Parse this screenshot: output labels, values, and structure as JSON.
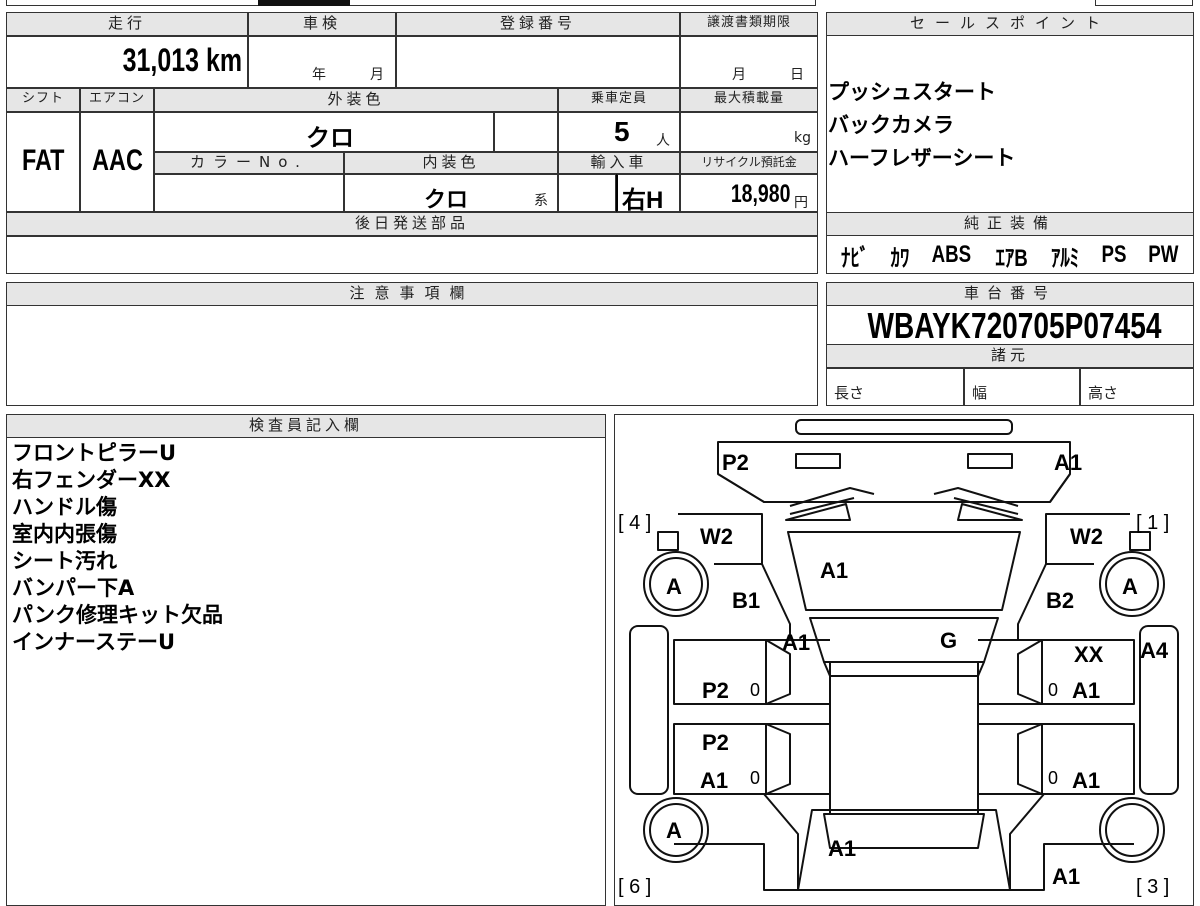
{
  "header": {
    "mileage_label": "走行",
    "inspection_label": "車検",
    "registration_label": "登録番号",
    "transfer_deadline_label": "譲渡書類期限",
    "shift_label": "シフト",
    "aircon_label": "エアコン",
    "exterior_color_label": "外装色",
    "capacity_label": "乗車定員",
    "max_load_label": "最大積載量",
    "color_no_label": "カラーNo.",
    "interior_color_label": "内装色",
    "import_label": "輸入車",
    "recycle_label": "リサイクル預託金"
  },
  "values": {
    "mileage": "31,013 km",
    "inspection_year_unit": "年",
    "inspection_month_unit": "月",
    "deadline_month_unit": "月",
    "deadline_day_unit": "日",
    "shift": "FAT",
    "aircon": "AAC",
    "exterior_color": "クロ",
    "capacity": "5",
    "capacity_unit": "人",
    "max_load_unit": "kg",
    "interior_color": "クロ",
    "interior_suffix": "系",
    "import_type": "右H",
    "recycle_fee": "18,980",
    "recycle_unit": "円"
  },
  "later_parts_label": "後日発送部品",
  "notes_label": "注意事項欄",
  "sales_points": {
    "label": "セールスポイント",
    "items": [
      "プッシュスタート",
      "バックカメラ",
      "ハーフレザーシート"
    ]
  },
  "genuine_equipment": {
    "label": "純正装備",
    "items": [
      "ﾅﾋﾞ",
      "ｶﾜ",
      "ABS",
      "ｴｱB",
      "ｱﾙﾐ",
      "PS",
      "PW"
    ]
  },
  "chassis": {
    "label": "車台番号",
    "number": "WBAYK720705P07454"
  },
  "specs": {
    "label": "諸元",
    "length_label": "長さ",
    "width_label": "幅",
    "height_label": "高さ"
  },
  "inspector": {
    "label": "検査員記入欄",
    "lines": [
      "フロントピラーU",
      "右フェンダーXX",
      "ハンドル傷",
      "室内内張傷",
      "シート汚れ",
      "バンパー下A",
      "パンク修理キット欠品",
      "インナーステーU"
    ]
  },
  "diagram": {
    "corners": [
      "[ 4 ]",
      "[ 1 ]",
      "[ 6 ]",
      "[ 3 ]"
    ],
    "marks": [
      "P2",
      "A1",
      "W2",
      "W2",
      "A",
      "A",
      "A1",
      "B1",
      "B2",
      "A1",
      "G",
      "A4",
      "XX",
      "P2",
      "A1",
      "P2",
      "A1",
      "A1",
      "A1",
      "A",
      "A1",
      "A1"
    ],
    "zeros": [
      "0",
      "0",
      "0",
      "0"
    ]
  }
}
